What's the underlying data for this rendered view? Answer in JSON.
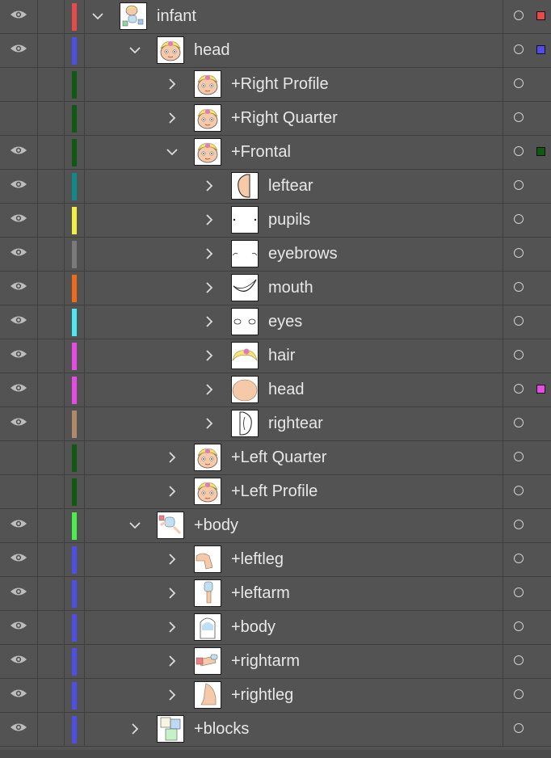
{
  "panel": {
    "title": ""
  },
  "layers": [
    {
      "name": "infant",
      "depth": 0,
      "visible": true,
      "expanded": true,
      "color": "#e84a4a",
      "thumb": "infant",
      "selected_color": "#e84a4a"
    },
    {
      "name": "head",
      "depth": 1,
      "visible": true,
      "expanded": true,
      "color": "#4e4ee8",
      "thumb": "face",
      "selected_color": "#4e4ee8"
    },
    {
      "name": "+Right Profile",
      "depth": 2,
      "visible": false,
      "expanded": false,
      "color": "#0e5a12",
      "thumb": "face",
      "selected_color": ""
    },
    {
      "name": "+Right Quarter",
      "depth": 2,
      "visible": false,
      "expanded": false,
      "color": "#0e5a12",
      "thumb": "face",
      "selected_color": ""
    },
    {
      "name": "+Frontal",
      "depth": 2,
      "visible": true,
      "expanded": true,
      "color": "#0e5a12",
      "thumb": "face",
      "selected_color": "#0e5a12"
    },
    {
      "name": "leftear",
      "depth": 3,
      "visible": true,
      "expanded": false,
      "color": "#0f8a8a",
      "thumb": "ear",
      "selected_color": ""
    },
    {
      "name": "pupils",
      "depth": 3,
      "visible": true,
      "expanded": false,
      "color": "#f0f040",
      "thumb": "pupils",
      "selected_color": ""
    },
    {
      "name": "eyebrows",
      "depth": 3,
      "visible": true,
      "expanded": false,
      "color": "#7a7a7a",
      "thumb": "eyebrows",
      "selected_color": ""
    },
    {
      "name": "mouth",
      "depth": 3,
      "visible": true,
      "expanded": false,
      "color": "#f06a1a",
      "thumb": "mouth",
      "selected_color": ""
    },
    {
      "name": "eyes",
      "depth": 3,
      "visible": true,
      "expanded": false,
      "color": "#4ae8f0",
      "thumb": "eyes",
      "selected_color": ""
    },
    {
      "name": "hair",
      "depth": 3,
      "visible": true,
      "expanded": false,
      "color": "#e84ae8",
      "thumb": "hair",
      "selected_color": ""
    },
    {
      "name": "head",
      "depth": 3,
      "visible": true,
      "expanded": false,
      "color": "#e84ae8",
      "thumb": "headshape",
      "selected_color": "#e84ae8"
    },
    {
      "name": "rightear",
      "depth": 3,
      "visible": true,
      "expanded": false,
      "color": "#b08a68",
      "thumb": "rightear",
      "selected_color": ""
    },
    {
      "name": "+Left Quarter",
      "depth": 2,
      "visible": false,
      "expanded": false,
      "color": "#0e5a12",
      "thumb": "face",
      "selected_color": ""
    },
    {
      "name": "+Left Profile",
      "depth": 2,
      "visible": false,
      "expanded": false,
      "color": "#0e5a12",
      "thumb": "face",
      "selected_color": ""
    },
    {
      "name": "+body",
      "depth": 1,
      "visible": true,
      "expanded": true,
      "color": "#4aee4a",
      "thumb": "body",
      "selected_color": ""
    },
    {
      "name": "+leftleg",
      "depth": 2,
      "visible": true,
      "expanded": false,
      "color": "#4e4ee8",
      "thumb": "leg",
      "selected_color": ""
    },
    {
      "name": "+leftarm",
      "depth": 2,
      "visible": true,
      "expanded": false,
      "color": "#4e4ee8",
      "thumb": "arm",
      "selected_color": ""
    },
    {
      "name": "+body",
      "depth": 2,
      "visible": true,
      "expanded": false,
      "color": "#4e4ee8",
      "thumb": "torso",
      "selected_color": ""
    },
    {
      "name": "+rightarm",
      "depth": 2,
      "visible": true,
      "expanded": false,
      "color": "#4e4ee8",
      "thumb": "rightarm",
      "selected_color": ""
    },
    {
      "name": "+rightleg",
      "depth": 2,
      "visible": true,
      "expanded": false,
      "color": "#4e4ee8",
      "thumb": "rightleg",
      "selected_color": ""
    },
    {
      "name": "+blocks",
      "depth": 1,
      "visible": true,
      "expanded": false,
      "color": "#4e4ee8",
      "thumb": "blocks",
      "selected_color": ""
    }
  ]
}
